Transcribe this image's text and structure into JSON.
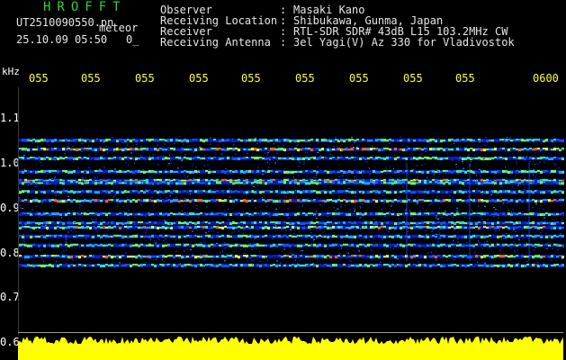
{
  "header": {
    "app_title": "HROFFT",
    "file_name": "UT2510090550.pn",
    "mode": "meteor",
    "date_time": "25.10.09 05:50",
    "zero_mark": "0_"
  },
  "info": [
    {
      "key": "Observer",
      "value": "Masaki Kano"
    },
    {
      "key": "Receiving Location",
      "value": "Shibukawa, Gunma, Japan"
    },
    {
      "key": "Receiver",
      "value": "RTL-SDR SDR# 43dB L15 103.2MHz CW"
    },
    {
      "key": "Receiving Antenna",
      "value": "3el Yagi(V) Az 330 for Vladivostok"
    }
  ],
  "info_separator": ":",
  "axis": {
    "unit": "kHz",
    "time_ticks": [
      "055",
      "055",
      "055",
      "055",
      "055",
      "055",
      "055",
      "055",
      "055",
      "0600"
    ],
    "freq_ticks": [
      "1.1",
      "1.0",
      "0.9",
      "0.8",
      "0.7",
      "0.6"
    ]
  },
  "colors": {
    "background": "#000000",
    "title": "#27d63a",
    "text": "#e6e6e6",
    "time_ticks": "#ffff33",
    "level": "#ffff00"
  },
  "spectrum_bands_khz": [
    1.05,
    1.03,
    1.01,
    0.98,
    0.96,
    0.955,
    0.935,
    0.915,
    0.885,
    0.865,
    0.855,
    0.835,
    0.815,
    0.79,
    0.77
  ]
}
